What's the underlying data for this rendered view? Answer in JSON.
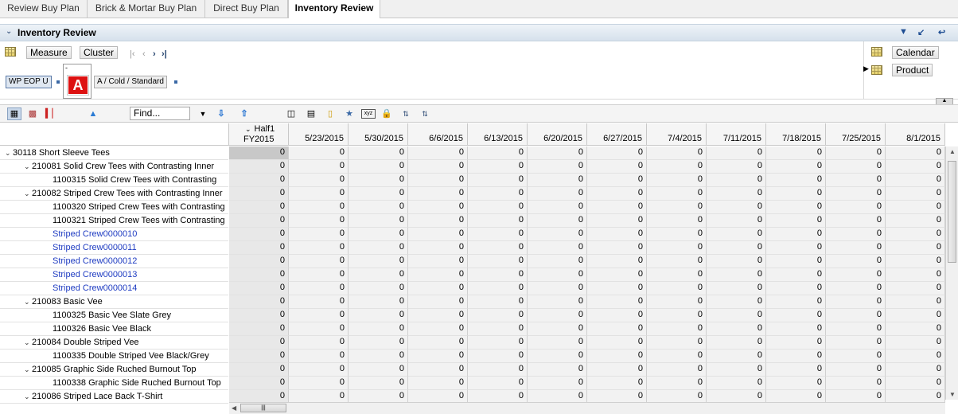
{
  "tabs": [
    {
      "label": "Review Buy Plan"
    },
    {
      "label": "Brick & Mortar Buy Plan"
    },
    {
      "label": "Direct Buy Plan"
    },
    {
      "label": "Inventory Review",
      "active": true
    }
  ],
  "panel": {
    "title": "Inventory Review"
  },
  "pivot": {
    "measure_label": "Measure",
    "cluster_label": "Cluster",
    "wp_chip": "WP EOP U",
    "alert_top": "-",
    "alert_letter": "A",
    "cluster_chip": "A / Cold / Standard",
    "calendar_label": "Calendar",
    "product_label": "Product"
  },
  "toolbar": {
    "find_placeholder": "Find..."
  },
  "columns": [
    "Half1\nFY2015",
    "5/23/2015",
    "5/30/2015",
    "6/6/2015",
    "6/13/2015",
    "6/20/2015",
    "6/27/2015",
    "7/4/2015",
    "7/11/2015",
    "7/18/2015",
    "7/25/2015",
    "8/1/2015"
  ],
  "column_half_line1": "Half1",
  "column_half_line2": "FY2015",
  "rows": [
    {
      "label": "30118 Short Sleeve Tees",
      "level": 0,
      "expander": true,
      "link": false
    },
    {
      "label": "210081 Solid Crew Tees with Contrasting Inner",
      "level": 1,
      "expander": true,
      "link": false
    },
    {
      "label": "1100315 Solid Crew Tees with Contrasting",
      "level": 2,
      "expander": false,
      "link": false
    },
    {
      "label": "210082 Striped Crew Tees with Contrasting Inner",
      "level": 1,
      "expander": true,
      "link": false
    },
    {
      "label": "1100320 Striped Crew Tees with Contrasting",
      "level": 2,
      "expander": false,
      "link": false
    },
    {
      "label": "1100321 Striped Crew Tees with Contrasting",
      "level": 2,
      "expander": false,
      "link": false
    },
    {
      "label": "Striped Crew0000010",
      "level": 2,
      "expander": false,
      "link": true
    },
    {
      "label": "Striped Crew0000011",
      "level": 2,
      "expander": false,
      "link": true
    },
    {
      "label": "Striped Crew0000012",
      "level": 2,
      "expander": false,
      "link": true
    },
    {
      "label": "Striped Crew0000013",
      "level": 2,
      "expander": false,
      "link": true
    },
    {
      "label": "Striped Crew0000014",
      "level": 2,
      "expander": false,
      "link": true
    },
    {
      "label": "210083 Basic Vee",
      "level": 1,
      "expander": true,
      "link": false
    },
    {
      "label": "1100325 Basic Vee Slate Grey",
      "level": 2,
      "expander": false,
      "link": false
    },
    {
      "label": "1100326 Basic Vee Black",
      "level": 2,
      "expander": false,
      "link": false
    },
    {
      "label": "210084 Double Striped Vee",
      "level": 1,
      "expander": true,
      "link": false
    },
    {
      "label": "1100335 Double Striped Vee Black/Grey",
      "level": 2,
      "expander": false,
      "link": false
    },
    {
      "label": "210085 Graphic Side Ruched Burnout Top",
      "level": 1,
      "expander": true,
      "link": false
    },
    {
      "label": "1100338 Graphic Side Ruched Burnout Top",
      "level": 2,
      "expander": false,
      "link": false
    },
    {
      "label": "210086 Striped Lace Back T-Shirt",
      "level": 1,
      "expander": true,
      "link": false
    }
  ],
  "cell_value": "0"
}
